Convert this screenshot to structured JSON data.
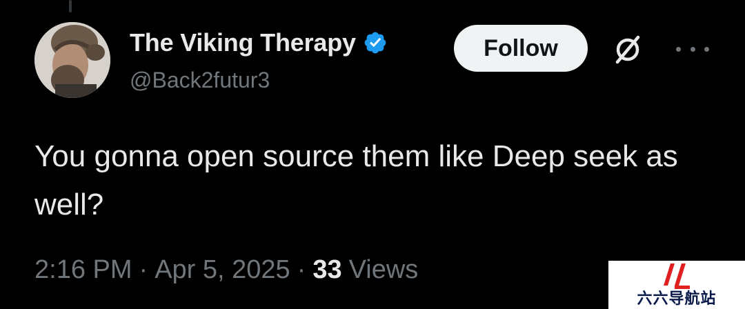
{
  "author": {
    "display_name": "The Viking Therapy",
    "handle": "@Back2futur3",
    "verified": true,
    "verified_color": "#1d9bf0",
    "avatar": "avatar-photo"
  },
  "actions": {
    "follow_label": "Follow",
    "grok_icon": "grok-icon",
    "more_icon": "more-options-icon"
  },
  "tweet": {
    "text": "You gonna open source them like Deep seek as well?"
  },
  "meta": {
    "time": "2:16 PM",
    "separator": "·",
    "date": "Apr 5, 2025",
    "views_count": "33",
    "views_label": "Views"
  },
  "watermark": {
    "text": "六六导航站",
    "logo_color": "#e02020"
  },
  "colors": {
    "background": "#000000",
    "primary_text": "#e7e9ea",
    "secondary_text": "#71767b",
    "button_bg": "#eff3f4"
  }
}
